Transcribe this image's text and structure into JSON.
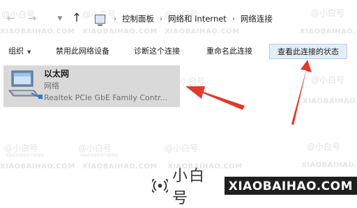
{
  "nav": {
    "back_icon": "arrow-left-icon",
    "forward_icon": "arrow-right-icon",
    "recent_icon": "chevron-down-icon",
    "up_icon": "arrow-up-icon"
  },
  "breadcrumb": {
    "icon": "control-panel-icon",
    "items": [
      "控制面板",
      "网络和 Internet",
      "网络连接"
    ]
  },
  "toolbar": {
    "organize": "组织",
    "disable": "禁用此网络设备",
    "diagnose": "诊断这个连接",
    "rename": "重命名此连接",
    "view_status": "查看此连接的状态"
  },
  "connection": {
    "icon": "network-adapter-icon",
    "name": "以太网",
    "status": "网络",
    "adapter": "Realtek PCIe GbE Family Contr..."
  },
  "watermark": {
    "logo": "@小白号",
    "site": "XIAOBAIHAO.COM",
    "small": "电脑系统装机技巧教程站"
  },
  "brand": {
    "icon": "broadcast-icon",
    "cn": "小白号",
    "site": "XIAOBAIHAO.COM"
  },
  "colors": {
    "arrow": "#e03a2c",
    "selection": "#d9d9d9",
    "button_highlight": "#e4eef8"
  }
}
